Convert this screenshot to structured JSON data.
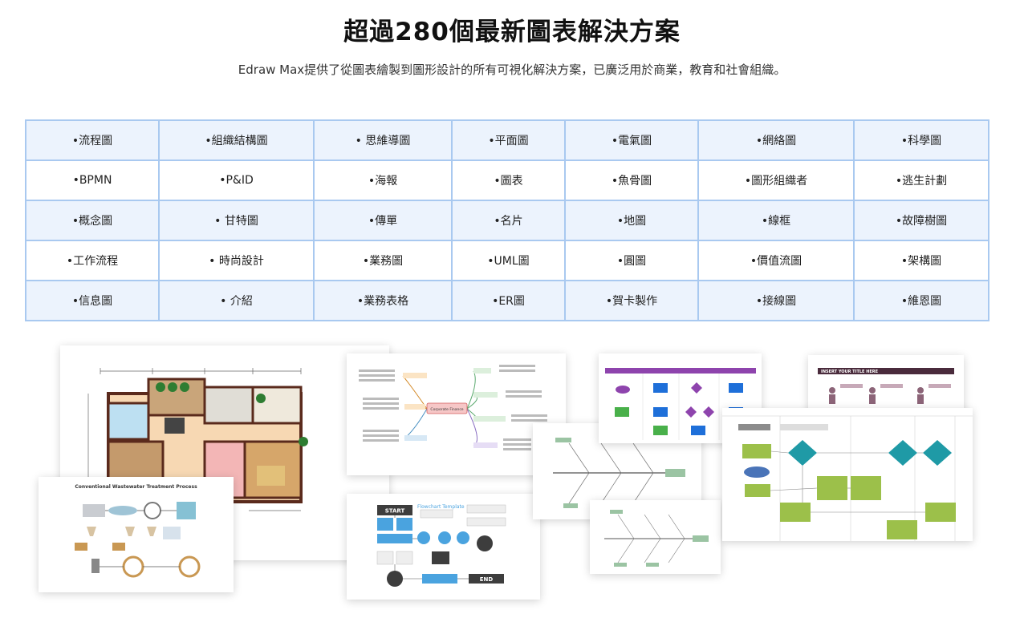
{
  "header": {
    "title": "超過280個最新圖表解決方案",
    "subtitle": "Edraw Max提供了從圖表繪製到圖形設計的所有可視化解決方案，已廣泛用於商業，教育和社會組織。"
  },
  "diagram_types": [
    [
      "•流程圖",
      "•組織結構圖",
      "• 思維導圖",
      "•平面圖",
      "•電氣圖",
      "•網絡圖",
      "•科學圖"
    ],
    [
      "•BPMN",
      "•P&ID",
      "•海報",
      "•圖表",
      "•魚骨圖",
      "•圖形組織者",
      "•逃生計劃"
    ],
    [
      "•概念圖",
      "• 甘特圖",
      "•傳單",
      "•名片",
      "•地圖",
      "•線框",
      "•故障樹圖"
    ],
    [
      "•工作流程",
      "• 時尚設計",
      "•業務圖",
      "•UML圖",
      "•圓圖",
      "•價值流圖",
      "•架構圖"
    ],
    [
      "•信息圖",
      "• 介紹",
      "•業務表格",
      "•ER圖",
      "•賀卡製作",
      "•接線圖",
      "•維恩圖"
    ]
  ],
  "thumbnails": {
    "wastewater_title": "Conventional Wastewater Treatment Process",
    "flowchart_title": "Flowchart Template",
    "flowchart_start": "START",
    "flowchart_end": "END",
    "mindmap_center": "Corporate Finance",
    "infographic_title": "INSERT YOUR TITLE HERE"
  }
}
